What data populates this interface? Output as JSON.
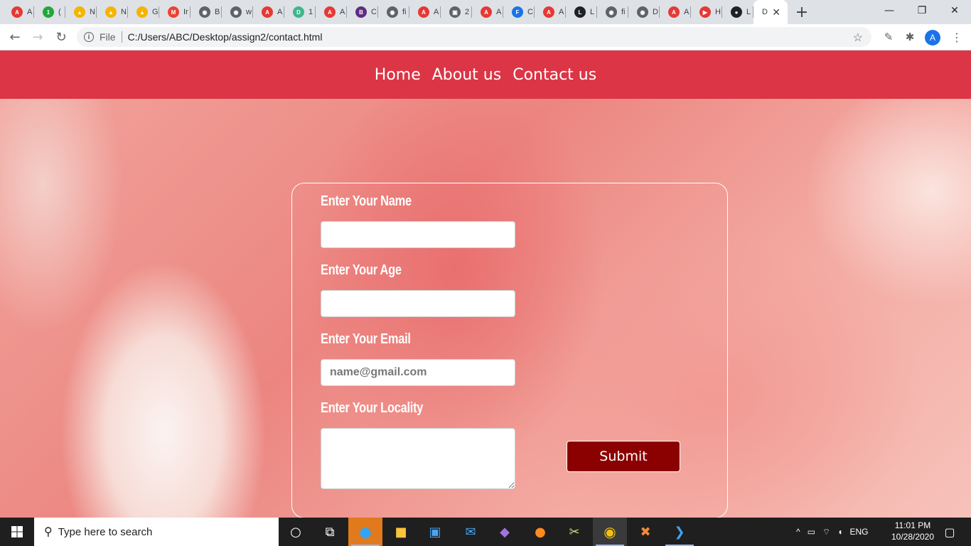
{
  "browser": {
    "tabs": [
      {
        "icon": "ask-icon",
        "letter": "A",
        "color": "#e53935",
        "title": "A"
      },
      {
        "icon": "one-icon",
        "letter": "1",
        "color": "#21a73b",
        "title": "("
      },
      {
        "icon": "drive-icon",
        "letter": "▲",
        "color": "#f4b400",
        "title": "N"
      },
      {
        "icon": "drive-icon",
        "letter": "▲",
        "color": "#f4b400",
        "title": "N"
      },
      {
        "icon": "drive-icon",
        "letter": "▲",
        "color": "#f4b400",
        "title": "G"
      },
      {
        "icon": "gmail-icon",
        "letter": "M",
        "color": "#ea4335",
        "title": "Ir"
      },
      {
        "icon": "globe-icon",
        "letter": "◉",
        "color": "#5f6368",
        "title": "B"
      },
      {
        "icon": "globe-icon",
        "letter": "◉",
        "color": "#5f6368",
        "title": "w"
      },
      {
        "icon": "ask-icon",
        "letter": "A",
        "color": "#e53935",
        "title": "A"
      },
      {
        "icon": "d-icon",
        "letter": "D",
        "color": "#3fb68b",
        "title": "1"
      },
      {
        "icon": "ask-icon",
        "letter": "A",
        "color": "#e53935",
        "title": "A"
      },
      {
        "icon": "b-icon",
        "letter": "B",
        "color": "#5f2c82",
        "title": "C"
      },
      {
        "icon": "globe-icon",
        "letter": "◉",
        "color": "#5f6368",
        "title": "fi"
      },
      {
        "icon": "ask-icon",
        "letter": "A",
        "color": "#e53935",
        "title": "A"
      },
      {
        "icon": "robot-icon",
        "letter": "▣",
        "color": "#5f6368",
        "title": "2"
      },
      {
        "icon": "ask-icon",
        "letter": "A",
        "color": "#e53935",
        "title": "A"
      },
      {
        "icon": "f-icon",
        "letter": "F",
        "color": "#1a73e8",
        "title": "C"
      },
      {
        "icon": "ask-icon",
        "letter": "A",
        "color": "#e53935",
        "title": "A"
      },
      {
        "icon": "l-icon",
        "letter": "L",
        "color": "#202124",
        "title": "L"
      },
      {
        "icon": "globe-icon",
        "letter": "◉",
        "color": "#5f6368",
        "title": "fi"
      },
      {
        "icon": "globe-icon",
        "letter": "◉",
        "color": "#5f6368",
        "title": "D"
      },
      {
        "icon": "ask-icon",
        "letter": "A",
        "color": "#e53935",
        "title": "A"
      },
      {
        "icon": "youtube-icon",
        "letter": "▶",
        "color": "#e53935",
        "title": "H"
      },
      {
        "icon": "github-icon",
        "letter": "●",
        "color": "#202124",
        "title": "L"
      }
    ],
    "active_tab": {
      "title": "D",
      "close": "✕"
    },
    "new_tab": "+",
    "window": {
      "minimize": "—",
      "restore": "❐",
      "close": "✕"
    },
    "nav": {
      "back": "←",
      "forward": "→",
      "reload": "↻"
    },
    "address": {
      "info": "i",
      "scheme_label": "File",
      "url": "C:/Users/ABC/Desktop/assign2/contact.html"
    },
    "star": "☆",
    "extensions": [
      "✎",
      "✱"
    ],
    "profile_initial": "A"
  },
  "page": {
    "nav": [
      "Home",
      "About us",
      "Contact us"
    ],
    "form": {
      "name_label": "Enter Your Name",
      "age_label": "Enter Your Age",
      "email_label": "Enter Your Email",
      "email_placeholder": "name@gmail.com",
      "locality_label": "Enter Your Locality",
      "submit_label": "Submit"
    }
  },
  "taskbar": {
    "search_placeholder": "Type here to search",
    "apps": [
      "cortana-icon",
      "task-view-icon",
      "edge-icon",
      "file-explorer-icon",
      "store-icon",
      "mail-icon",
      "visual-studio-icon",
      "firefox-icon",
      "tool-icon",
      "chrome-icon",
      "xampp-icon",
      "vscode-icon"
    ],
    "tray": {
      "language": "ENG"
    },
    "time": "11:01 PM",
    "date": "10/28/2020"
  }
}
